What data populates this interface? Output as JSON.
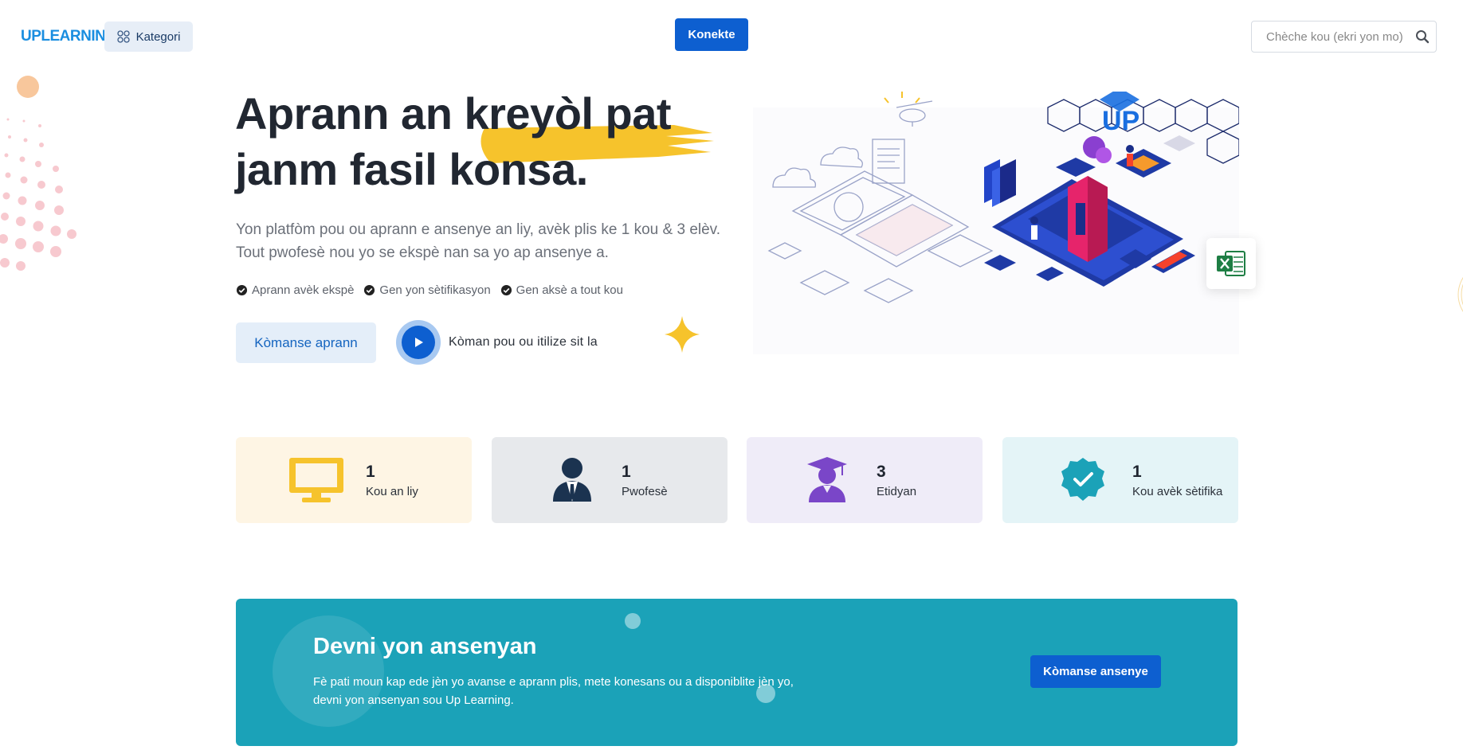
{
  "header": {
    "logo_text": "UPLEARNING",
    "category_label": "Kategori",
    "connect_label": "Konekte",
    "search_placeholder": "Chèche kou (ekri yon mo)"
  },
  "hero": {
    "title": "Aprann an kreyòl pat janm fasil konsa.",
    "description": "Yon platfòm pou ou aprann e ansenye an liy, avèk plis ke 1 kou & 3 elèv. Tout pwofesè nou yo se ekspè nan sa yo ap ansenye a.",
    "features": [
      "Aprann avèk ekspè",
      "Gen yon sètifikasyon",
      "Gen aksè a tout kou"
    ],
    "start_label": "Kòmanse aprann",
    "video_label": "Kòman pou ou itilize sit la",
    "accent_color": "#f6c32c"
  },
  "stats": [
    {
      "value": "1",
      "label": "Kou an liy",
      "icon": "monitor-icon",
      "color": "#f6c32c"
    },
    {
      "value": "1",
      "label": "Pwofesè",
      "icon": "teacher-icon",
      "color": "#1b3350"
    },
    {
      "value": "3",
      "label": "Etidyan",
      "icon": "graduate-icon",
      "color": "#7a46c8"
    },
    {
      "value": "1",
      "label": "Kou avèk sètifika",
      "icon": "certificate-badge-icon",
      "color": "#1ba2b8"
    }
  ],
  "banner": {
    "title": "Devni yon ansenyan",
    "text": "Fè pati moun kap ede jèn yo avanse e aprann plis, mete konesans ou a disponiblite jèn yo, devni yon ansenyan sou Up Learning.",
    "button_label": "Kòmanse ansenye",
    "background": "#1ba2b8"
  }
}
